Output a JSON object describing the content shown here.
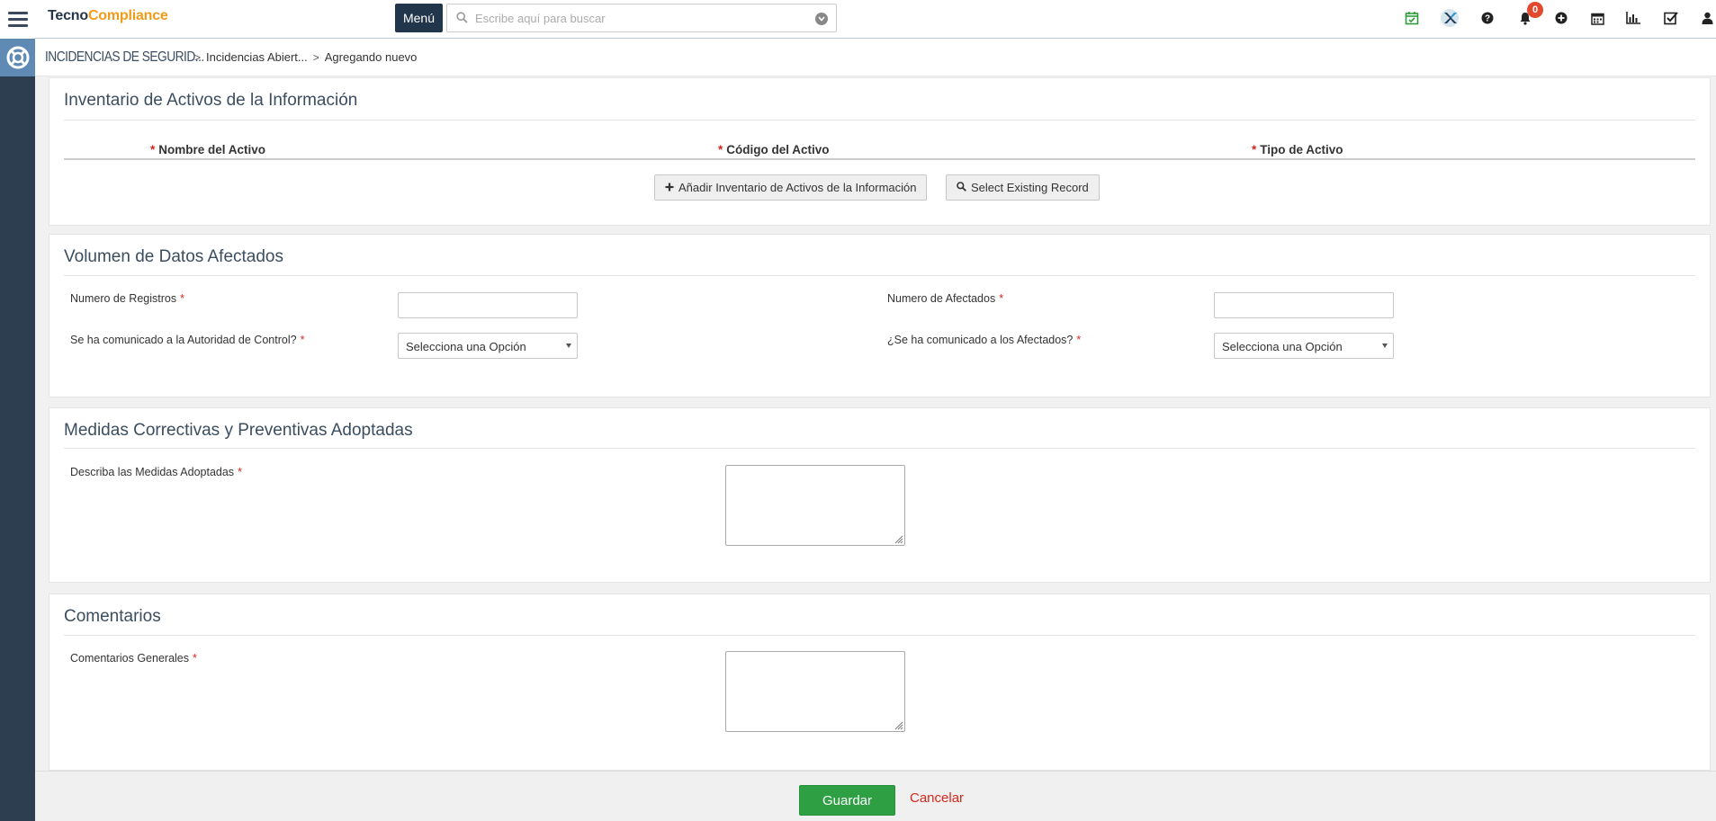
{
  "app": {
    "logo_part1": "Tecno",
    "logo_part2": "Compliance",
    "menu_label": "Menú",
    "search_placeholder": "Escribe aquí para buscar",
    "notification_count": "0",
    "accent_color": "#22364b",
    "brand_orange": "#f29a1a"
  },
  "toolbar_icons": [
    "calendar-check-icon",
    "x-logo-icon",
    "help-icon",
    "bell-icon",
    "plus-circle-icon",
    "calendar-icon",
    "bar-chart-icon",
    "checkbox-icon",
    "user-icon"
  ],
  "breadcrumb": {
    "module": "INCIDENCIAS DE SEGURID...",
    "level2": "Incidencias Abiert...",
    "level3": "Agregando nuevo"
  },
  "inventario": {
    "title": "Inventario de Activos de la Información",
    "columns": [
      "Nombre del Activo",
      "Código del Activo",
      "Tipo de Activo"
    ],
    "add_button": "Añadir Inventario de Activos de la Información",
    "select_button": "Select Existing Record"
  },
  "volumen": {
    "title": "Volumen de Datos Afectados",
    "numero_registros_label": "Numero de Registros",
    "numero_afectados_label": "Numero de Afectados",
    "autoridad_label": "Se ha comunicado a la Autoridad de Control?",
    "autoridad_value": "Selecciona una Opción",
    "afectados_label": "¿Se ha comunicado a los Afectados?",
    "afectados_value": "Selecciona una Opción"
  },
  "medidas": {
    "title": "Medidas Correctivas y Preventivas Adoptadas",
    "describa_label": "Describa las Medidas Adoptadas"
  },
  "comentarios": {
    "title": "Comentarios",
    "generales_label": "Comentarios Generales"
  },
  "footer": {
    "save_label": "Guardar",
    "cancel_label": "Cancelar"
  },
  "required_mark": "*"
}
